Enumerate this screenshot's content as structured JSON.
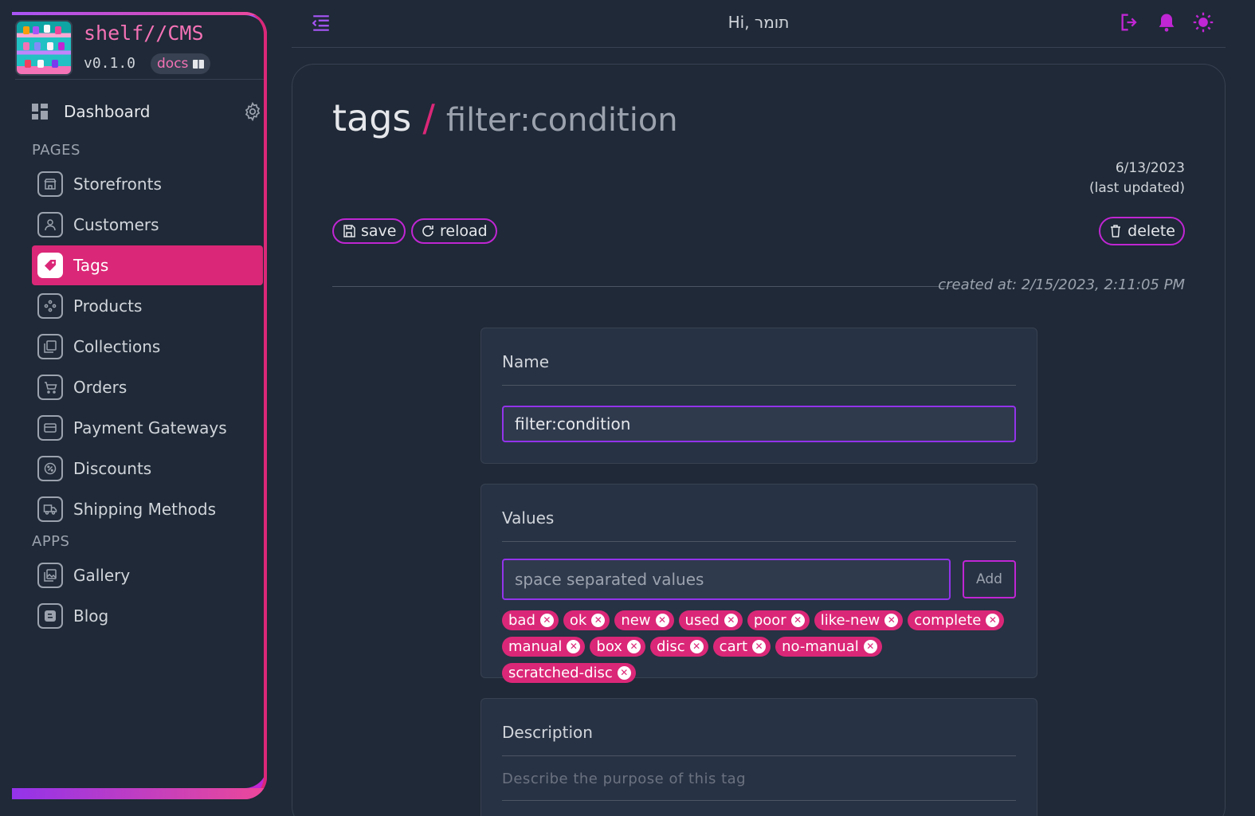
{
  "brand": {
    "name": "shelf//CMS",
    "version": "v0.1.0",
    "docs_label": "docs"
  },
  "sidebar": {
    "dashboard_label": "Dashboard",
    "pages_label": "PAGES",
    "apps_label": "APPS",
    "items": [
      {
        "label": "Storefronts",
        "icon": "storefront-icon"
      },
      {
        "label": "Customers",
        "icon": "customer-icon"
      },
      {
        "label": "Tags",
        "icon": "tag-icon",
        "active": true
      },
      {
        "label": "Products",
        "icon": "gamepad-icon"
      },
      {
        "label": "Collections",
        "icon": "collection-icon"
      },
      {
        "label": "Orders",
        "icon": "cart-icon"
      },
      {
        "label": "Payment Gateways",
        "icon": "card-icon"
      },
      {
        "label": "Discounts",
        "icon": "discount-icon"
      },
      {
        "label": "Shipping Methods",
        "icon": "truck-icon"
      }
    ],
    "apps": [
      {
        "label": "Gallery",
        "icon": "gallery-icon"
      },
      {
        "label": "Blog",
        "icon": "blog-icon"
      }
    ]
  },
  "topbar": {
    "greeting": "Hi, תומר"
  },
  "page": {
    "title": "tags",
    "separator": "/",
    "subtitle": "filter:condition",
    "updated_date": "6/13/2023",
    "updated_label": "(last updated)",
    "save_label": "save",
    "reload_label": "reload",
    "delete_label": "delete",
    "created_at": "created at: 2/15/2023, 2:11:05 PM"
  },
  "name_panel": {
    "label": "Name",
    "value": "filter:condition"
  },
  "values_panel": {
    "label": "Values",
    "placeholder": "space separated values",
    "add_label": "Add",
    "chips": [
      "bad",
      "ok",
      "new",
      "used",
      "poor",
      "like-new",
      "complete",
      "manual",
      "box",
      "disc",
      "cart",
      "no-manual",
      "scratched-disc"
    ]
  },
  "description_panel": {
    "label": "Description",
    "placeholder": "Describe the purpose of this tag"
  },
  "colors": {
    "accent": "#db2777",
    "border_accent": "#9333ea",
    "background": "#1f2937"
  }
}
